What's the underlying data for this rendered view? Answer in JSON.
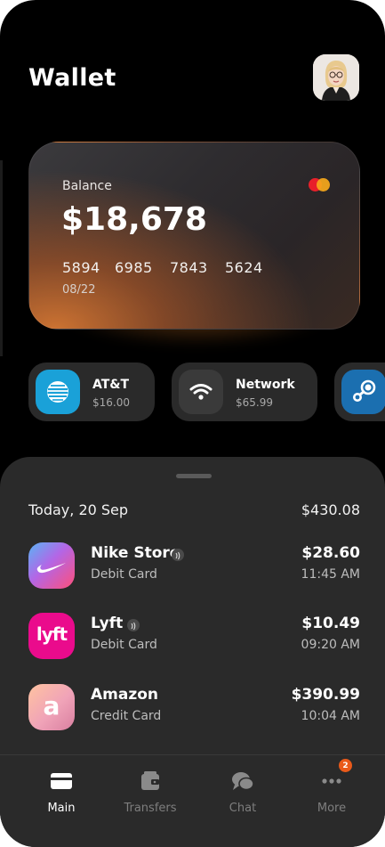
{
  "header": {
    "title": "Wallet"
  },
  "card": {
    "label": "Balance",
    "balance": "$18,678",
    "number_groups": [
      "5894",
      "6985",
      "7843",
      "5624"
    ],
    "expiry": "08/22",
    "network_icon": "mastercard-logo"
  },
  "subscriptions": [
    {
      "name": "AT&T",
      "price": "$16.00",
      "icon": "att-logo",
      "color": "#1aa1d8"
    },
    {
      "name": "Network",
      "price": "$65.99",
      "icon": "wifi-icon",
      "color": "#3a3a3a"
    },
    {
      "name": "",
      "price": "",
      "icon": "steam-logo",
      "color": "#1b6fb0"
    }
  ],
  "transactions_section": {
    "date": "Today, 20 Sep",
    "total": "$430.08",
    "items": [
      {
        "merchant": "Nike Store",
        "method": "Debit Card",
        "amount": "$28.60",
        "time": "11:45 AM",
        "icon": "nike-logo",
        "contactless": true
      },
      {
        "merchant": "Lyft",
        "method": "Debit Card",
        "amount": "$10.49",
        "time": "09:20 AM",
        "icon": "lyft-logo",
        "contactless": true
      },
      {
        "merchant": "Amazon",
        "method": "Credit Card",
        "amount": "$390.99",
        "time": "10:04 AM",
        "icon": "amazon-logo",
        "contactless": false
      }
    ]
  },
  "lyft_logo_text": "lyft",
  "amazon_logo_text": "a",
  "nav": {
    "items": [
      {
        "label": "Main",
        "icon": "card-icon",
        "active": true
      },
      {
        "label": "Transfers",
        "icon": "wallet-icon",
        "active": false
      },
      {
        "label": "Chat",
        "icon": "chat-icon",
        "active": false
      },
      {
        "label": "More",
        "icon": "more-icon",
        "active": false,
        "badge": "2"
      }
    ]
  },
  "colors": {
    "accent": "#ea5a1a",
    "sheet": "#2a2a2a",
    "background": "#000000"
  }
}
